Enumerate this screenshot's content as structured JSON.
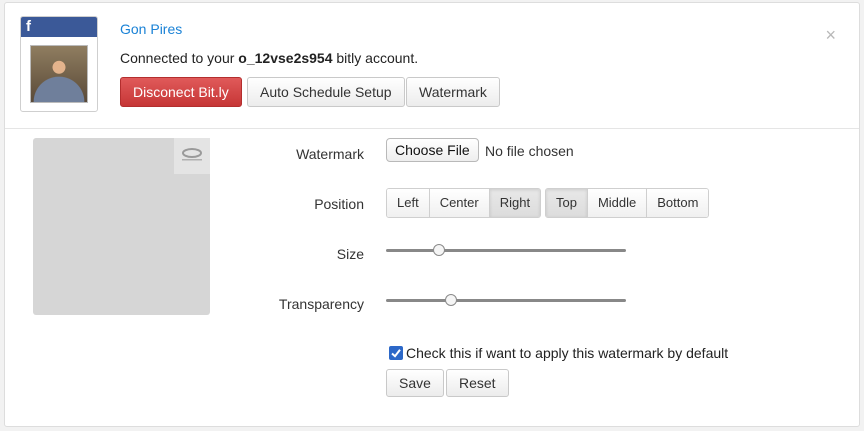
{
  "account": {
    "network_icon": "facebook-f-icon",
    "network_letter": "f",
    "user_name": "Gon Pires",
    "connected_prefix": "Connected to your ",
    "account_id": "o_12vse2s954",
    "connected_suffix": " bitly account."
  },
  "header_buttons": {
    "disconnect": "Disconect Bit.ly",
    "auto_schedule": "Auto Schedule Setup",
    "watermark": "Watermark"
  },
  "close_label": "×",
  "form": {
    "watermark_label": "Watermark",
    "choose_file": "Choose File",
    "no_file": "No file chosen",
    "position_label": "Position",
    "horizontal": [
      {
        "label": "Left",
        "active": false
      },
      {
        "label": "Center",
        "active": false
      },
      {
        "label": "Right",
        "active": true
      }
    ],
    "vertical": [
      {
        "label": "Top",
        "active": true
      },
      {
        "label": "Middle",
        "active": false
      },
      {
        "label": "Bottom",
        "active": false
      }
    ],
    "size_label": "Size",
    "size_value": 0.22,
    "transparency_label": "Transparency",
    "transparency_value": 0.27,
    "default_checked": true,
    "default_label": "Check this if want to apply this watermark by default",
    "save": "Save",
    "reset": "Reset"
  },
  "colors": {
    "facebook_blue": "#3b5998",
    "link_blue": "#1a82d6",
    "danger_red": "#d9534f",
    "checkbox_blue": "#2c68c8"
  }
}
